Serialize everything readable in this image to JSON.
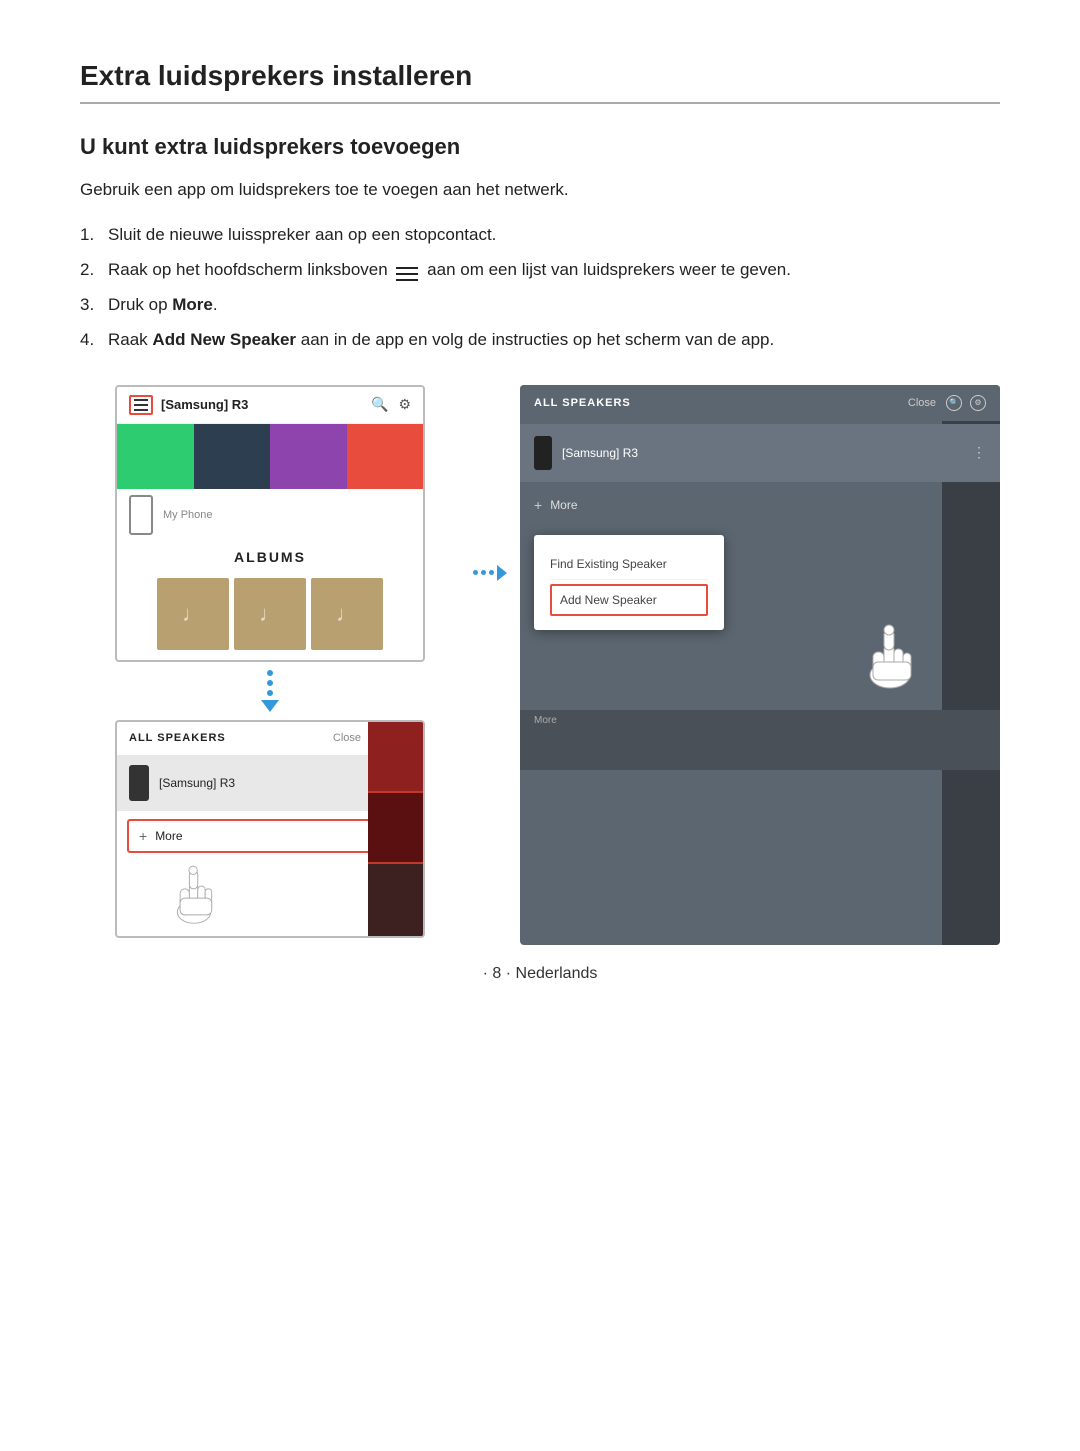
{
  "page": {
    "title": "Extra luidsprekers installeren",
    "section_heading": "U kunt extra luidsprekers toevoegen",
    "intro": "Gebruik een app om luidsprekers toe te voegen aan het netwerk.",
    "steps": [
      {
        "number": "1.",
        "text": "Sluit de nieuwe luisspreker aan op een stopcontact."
      },
      {
        "number": "2.",
        "text_before": "Raak op het hoofdscherm linksboven",
        "text_after": "aan om een lijst van luidsprekers weer te geven."
      },
      {
        "number": "3.",
        "text_before": "Druk op ",
        "bold": "More",
        "text_after": "."
      },
      {
        "number": "4.",
        "text_before": "Raak ",
        "bold": "Add New Speaker",
        "text_after": " aan in de app en volg de instructies op het scherm van de app."
      }
    ],
    "footer": "· 8 · Nederlands"
  },
  "top_screen": {
    "title": "[Samsung] R3",
    "albums_label": "ALBUMS",
    "my_phone_label": "My Phone"
  },
  "bottom_left_screen": {
    "speakers_title": "ALL SPEAKERS",
    "close_label": "Close",
    "speaker_name": "[Samsung] R3",
    "more_label": "More"
  },
  "right_screen": {
    "speakers_title": "ALL SPEAKERS",
    "close_label": "Close",
    "speaker_name": "[Samsung] R3",
    "more_label": "More",
    "popup": {
      "find_existing": "Find Existing Speaker",
      "add_new": "Add New Speaker"
    }
  }
}
